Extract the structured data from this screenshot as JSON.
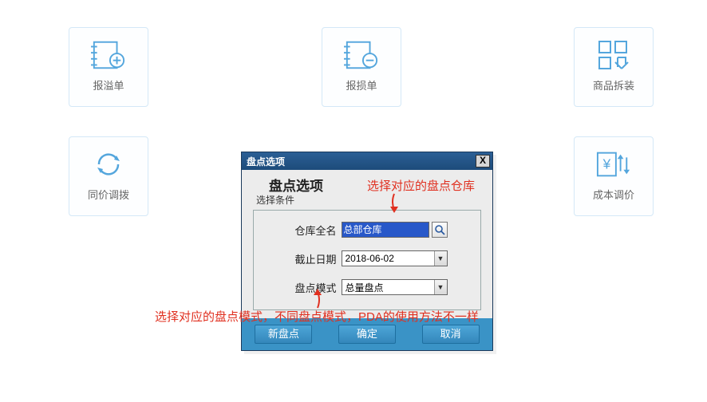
{
  "tiles": {
    "overflow": "报溢单",
    "loss": "报损单",
    "packaging": "商品拆装",
    "transfer": "同价调拨",
    "cost": "成本调价"
  },
  "dialog": {
    "titlebar": "盘点选项",
    "close_x": "X",
    "heading": "盘点选项",
    "sub": "选择条件",
    "fields": {
      "warehouse_label": "仓库全名",
      "warehouse_value": "总部仓库",
      "date_label": "截止日期",
      "date_value": "2018-06-02",
      "mode_label": "盘点模式",
      "mode_value": "总量盘点"
    },
    "buttons": {
      "new": "新盘点",
      "ok": "确定",
      "cancel": "取消"
    }
  },
  "annotations": {
    "top": "选择对应的盘点仓库",
    "bottom": "选择对应的盘点模式，不同盘点模式，PDA的使用方法不一样"
  }
}
